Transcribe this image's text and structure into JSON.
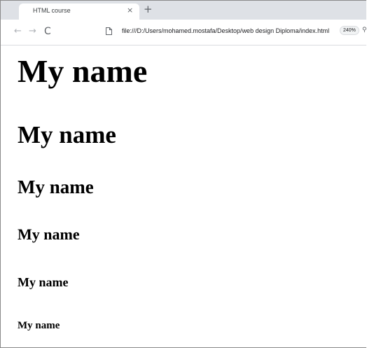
{
  "browser": {
    "tab": {
      "title": "HTML course",
      "close_glyph": "×"
    },
    "new_tab_glyph": "+",
    "toolbar": {
      "back_glyph": "←",
      "forward_glyph": "→",
      "reload_glyph": "C",
      "address": "file:///D:/Users/mohamed.mostafa/Desktop/web design Diploma/index.html",
      "zoom_level": "240%",
      "zoom_icon_glyph": "⚲"
    }
  },
  "page": {
    "headings": [
      {
        "level": 1,
        "text": "My name"
      },
      {
        "level": 2,
        "text": "My name"
      },
      {
        "level": 3,
        "text": "My name"
      },
      {
        "level": 4,
        "text": "My name"
      },
      {
        "level": 5,
        "text": "My name"
      },
      {
        "level": 6,
        "text": "My name"
      }
    ]
  }
}
